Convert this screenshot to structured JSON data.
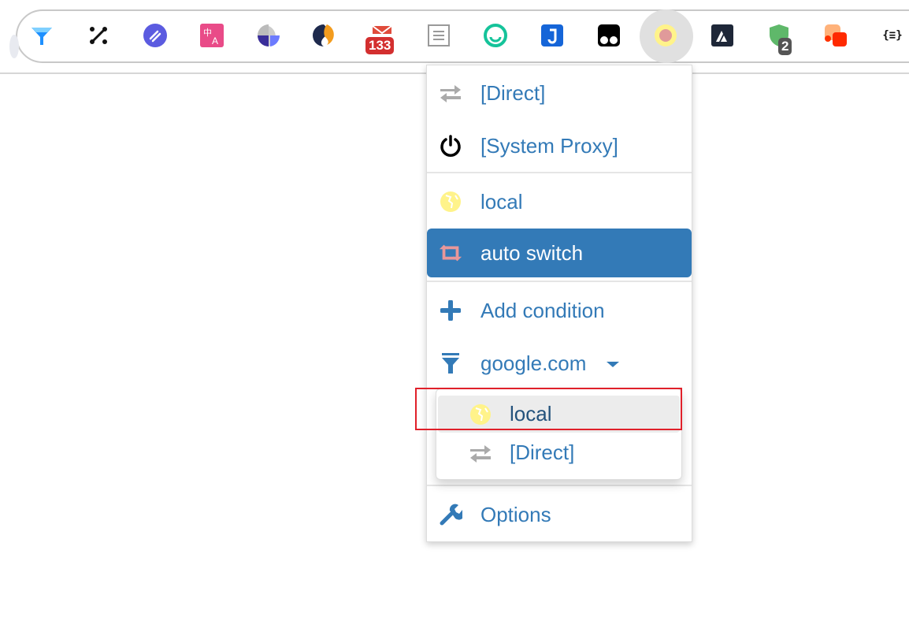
{
  "toolbar": {
    "extensions": [
      {
        "name": "funnel-extension-icon"
      },
      {
        "name": "graph-nodes-extension-icon"
      },
      {
        "name": "link-extension-icon"
      },
      {
        "name": "translate-extension-icon"
      },
      {
        "name": "simplenote-gray-extension-icon"
      },
      {
        "name": "simplenote-extension-icon"
      },
      {
        "name": "mail-extension-icon",
        "badge": "133"
      },
      {
        "name": "reader-extension-icon"
      },
      {
        "name": "grammarly-extension-icon"
      },
      {
        "name": "j-extension-icon"
      },
      {
        "name": "tampermonkey-extension-icon"
      },
      {
        "name": "proxy-switch-extension-icon",
        "active": true
      },
      {
        "name": "a-logo-extension-icon"
      },
      {
        "name": "shield-check-extension-icon",
        "badge": "2"
      },
      {
        "name": "squares-extension-icon"
      },
      {
        "name": "json-formatter-extension-icon",
        "label": "{≡}"
      }
    ]
  },
  "menu": {
    "items": [
      {
        "label": "[Direct]",
        "icon": "direct-arrows-icon"
      },
      {
        "label": "[System Proxy]",
        "icon": "power-icon"
      },
      {
        "label": "local",
        "icon": "globe-icon"
      },
      {
        "label": "auto switch",
        "icon": "retweet-icon",
        "selected": true
      },
      {
        "label": "Add condition",
        "icon": "plus-icon"
      },
      {
        "label": "google.com",
        "icon": "filter-icon"
      },
      {
        "label": "Options",
        "icon": "wrench-icon"
      }
    ],
    "submenu": [
      {
        "label": "local",
        "icon": "globe-icon",
        "highlighted": true
      },
      {
        "label": "[Direct]",
        "icon": "direct-arrows-icon"
      }
    ]
  },
  "colors": {
    "accent": "#337ab7",
    "highlight_box": "#e0202a",
    "globe": "#fff38a",
    "retweet": "#e8979a"
  }
}
